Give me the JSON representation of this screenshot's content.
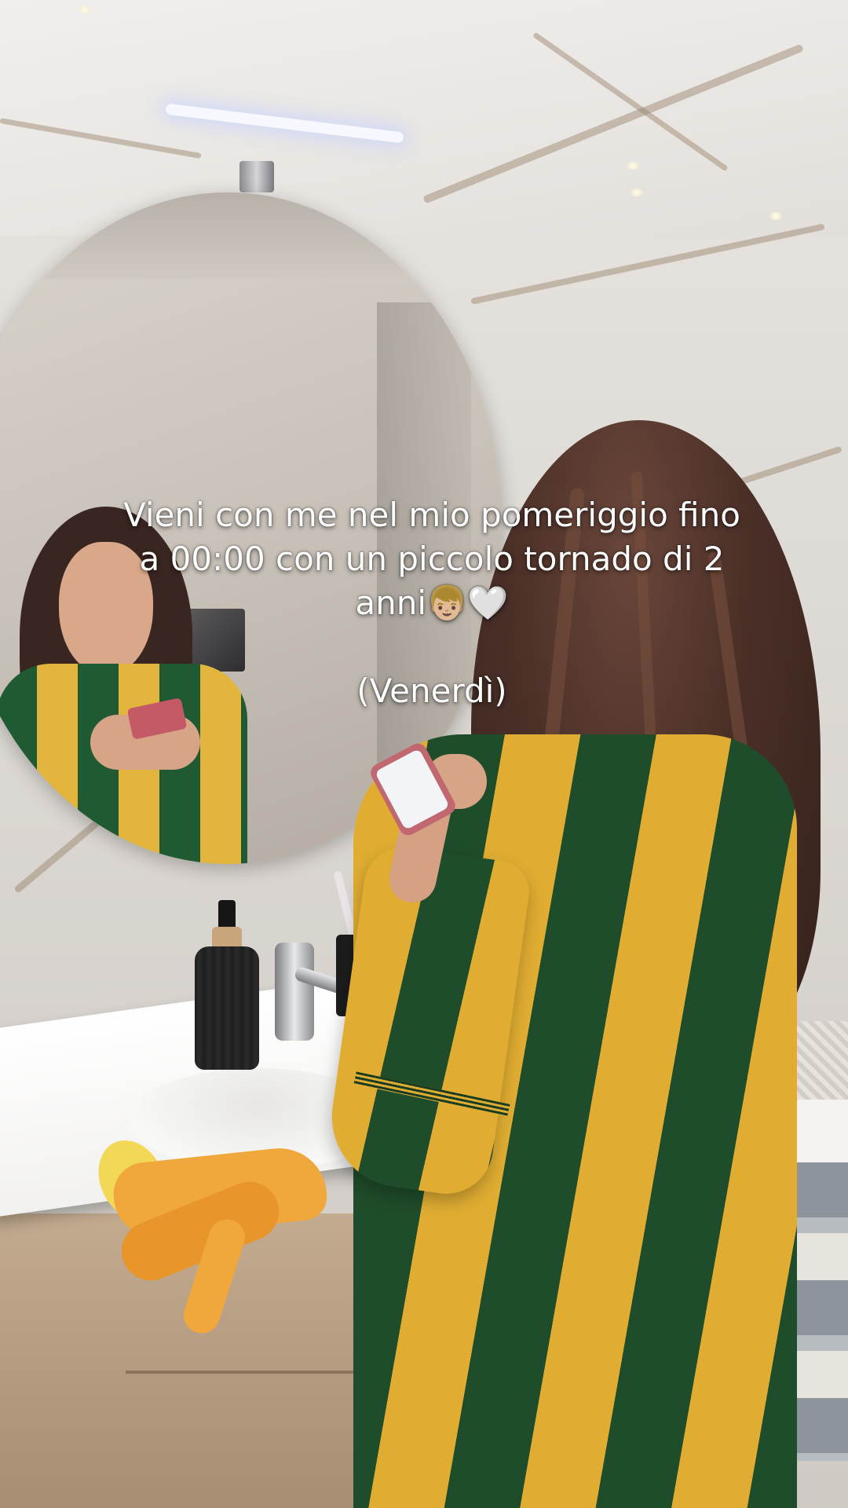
{
  "caption": {
    "line1": "Vieni con me nel mio pomeriggio fino",
    "line2": "a 00:00 con un piccolo tornado di 2",
    "line3": "anni👦🏼🤍",
    "line4": "(Venerdì)"
  },
  "colors": {
    "jersey_green": "#1f4c2a",
    "jersey_yellow": "#e0ad32",
    "glove_orange": "#f0a73b",
    "caption_text": "#ffffff"
  }
}
